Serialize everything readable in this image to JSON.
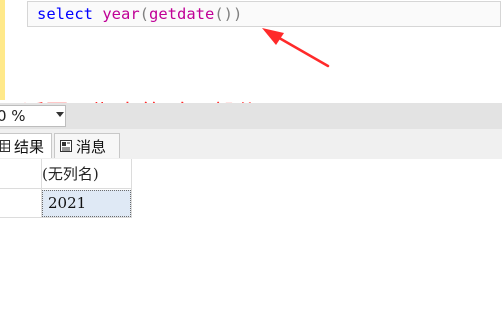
{
  "editor": {
    "code_tokens": {
      "select": "select",
      "space1": " ",
      "year": "year",
      "paren_open1": "(",
      "getdate": "getdate",
      "parens2": "()",
      "paren_close1": ")"
    }
  },
  "annotation": {
    "text": "返回日期中的“年”部分",
    "color": "#ff2a2a"
  },
  "zoom": {
    "value": "0 %"
  },
  "tabs": [
    {
      "label": "结果",
      "icon": "results-grid-icon",
      "active": true
    },
    {
      "label": "消息",
      "icon": "messages-icon",
      "active": false
    }
  ],
  "results": {
    "columns": [
      "(无列名)"
    ],
    "rows": [
      [
        "2021"
      ]
    ]
  },
  "colors": {
    "keyword": "#0000ff",
    "function": "#c00096",
    "operator": "#808080",
    "selected_cell": "#dfe9f5"
  }
}
